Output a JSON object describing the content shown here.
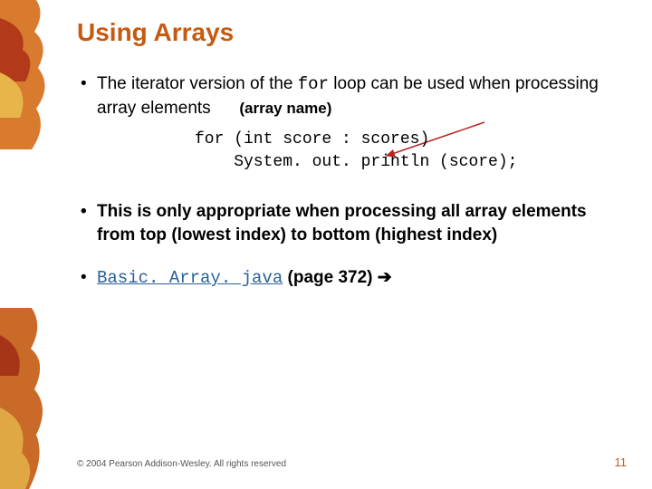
{
  "title": "Using Arrays",
  "bullet1": {
    "prefix": "The iterator version of the ",
    "code": "for",
    "middle": " loop can be used when processing array elements",
    "annotation": "(array name)"
  },
  "code": {
    "line1": "for (int score : scores)",
    "line2": "    System. out. println (score);"
  },
  "bullet2": "This is only appropriate when processing all array elements from top (lowest index) to bottom (highest index)",
  "bullet3": {
    "link": "Basic. Array. java",
    "page": " (page 372) ",
    "arrow": "➔"
  },
  "footer": {
    "copyright": "© 2004 Pearson Addison-Wesley. All rights reserved",
    "page": "11"
  }
}
